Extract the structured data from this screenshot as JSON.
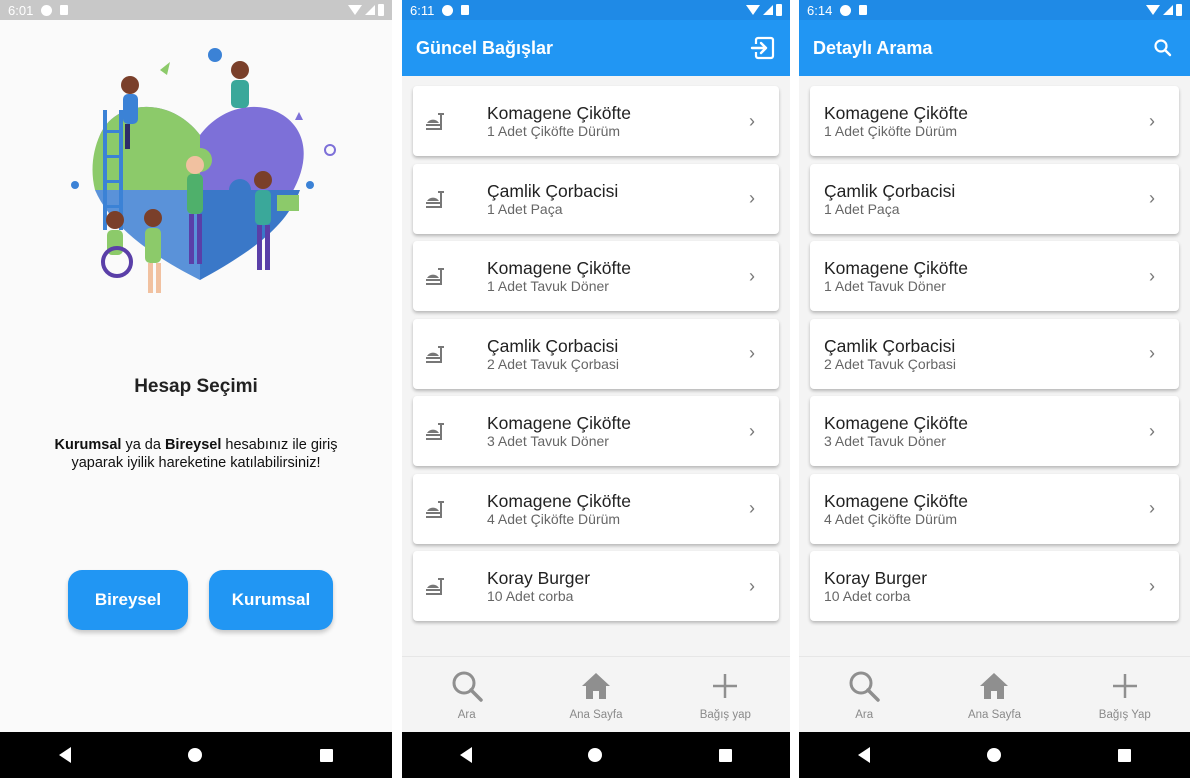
{
  "screen1": {
    "status": {
      "time": "6:01"
    },
    "heading": "Hesap Seçimi",
    "description": {
      "bold1": "Kurumsal",
      "text1": " ya da ",
      "bold2": "Bireysel",
      "text2": " hesabınız ile giriş yaparak iyilik  hareketine katılabilirsiniz!"
    },
    "buttons": {
      "individual": "Bireysel",
      "corporate": "Kurumsal"
    }
  },
  "screen2": {
    "status": {
      "time": "6:11"
    },
    "title": "Güncel Bağışlar",
    "action_icon": "logout-icon",
    "items": [
      {
        "name": "Komagene Çiköfte",
        "detail": "1 Adet  Çiköfte Dürüm"
      },
      {
        "name": "Çamlik Çorbacisi",
        "detail": "1 Adet  Paça"
      },
      {
        "name": "Komagene Çiköfte",
        "detail": "1 Adet  Tavuk Döner"
      },
      {
        "name": "Çamlik Çorbacisi",
        "detail": "2 Adet  Tavuk Çorbasi"
      },
      {
        "name": "Komagene Çiköfte",
        "detail": "3 Adet  Tavuk Döner"
      },
      {
        "name": "Komagene Çiköfte",
        "detail": "4 Adet  Çiköfte Dürüm"
      },
      {
        "name": "Koray Burger",
        "detail": "10 Adet  corba"
      }
    ],
    "nav": {
      "search": "Ara",
      "home": "Ana Sayfa",
      "donate": "Bağış yap"
    }
  },
  "screen3": {
    "status": {
      "time": "6:14"
    },
    "title": "Detaylı Arama",
    "action_icon": "search-icon",
    "items": [
      {
        "name": "Komagene Çiköfte",
        "detail": "1 Adet  Çiköfte Dürüm"
      },
      {
        "name": "Çamlik Çorbacisi",
        "detail": "1 Adet  Paça"
      },
      {
        "name": "Komagene Çiköfte",
        "detail": "1 Adet  Tavuk Döner"
      },
      {
        "name": "Çamlik Çorbacisi",
        "detail": "2 Adet  Tavuk Çorbasi"
      },
      {
        "name": "Komagene Çiköfte",
        "detail": "3 Adet  Tavuk Döner"
      },
      {
        "name": "Komagene Çiköfte",
        "detail": "4 Adet  Çiköfte Dürüm"
      },
      {
        "name": "Koray Burger",
        "detail": "10 Adet  corba"
      }
    ],
    "nav": {
      "search": "Ara",
      "home": "Ana Sayfa",
      "donate": "Bağış Yap"
    }
  },
  "colors": {
    "primary": "#2196f3",
    "status_blue": "#1f8ae6",
    "background": "#f4f4f4"
  }
}
